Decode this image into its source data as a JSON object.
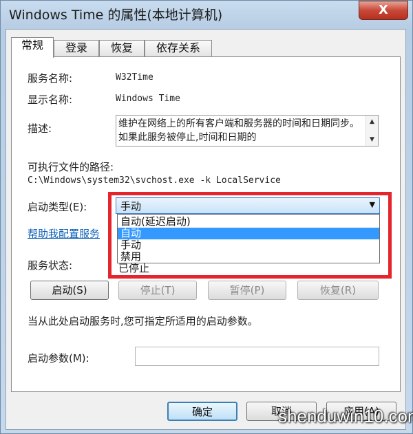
{
  "window": {
    "title": "Windows Time 的属性(本地计算机)",
    "close_glyph": "X"
  },
  "tabs": [
    {
      "label": "常规"
    },
    {
      "label": "登录"
    },
    {
      "label": "恢复"
    },
    {
      "label": "依存关系"
    }
  ],
  "general": {
    "service_name_label": "服务名称:",
    "service_name_value": "W32Time",
    "display_name_label": "显示名称:",
    "display_name_value": "Windows Time",
    "description_label": "描述:",
    "description_value": "维护在网络上的所有客户端和服务器的时间和日期同步。如果此服务被停止,时间和日期的",
    "path_label": "可执行文件的路径:",
    "path_value": "C:\\Windows\\system32\\svchost.exe -k LocalService",
    "startup_type_label": "启动类型(E):",
    "startup_type_value": "手动",
    "startup_options": [
      "自动(延迟启动)",
      "自动",
      "手动",
      "禁用"
    ],
    "startup_selected_index": 1,
    "help_link": "帮助我配置服务",
    "status_label": "服务状态:",
    "status_value": "已停止",
    "btn_start": "启动(S)",
    "btn_stop": "停止(T)",
    "btn_pause": "暂停(P)",
    "btn_resume": "恢复(R)",
    "hint": "当从此处启动服务时,您可指定所适用的启动参数。",
    "params_label": "启动参数(M):",
    "params_value": ""
  },
  "footer": {
    "ok": "确定",
    "cancel": "取消",
    "apply": "应用(A)"
  },
  "watermark": "shenduwin10.com",
  "colors": {
    "highlight": "#e4262c",
    "selection": "#3399ff",
    "link": "#0b5fb8"
  }
}
